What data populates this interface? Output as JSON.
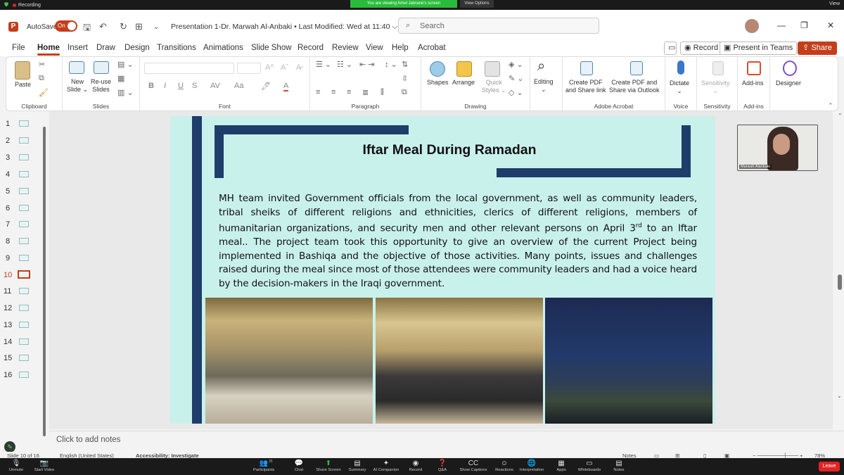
{
  "zoom": {
    "recording_label": "Recording",
    "viewing_banner": "You are viewing Amel Jabrane's screen",
    "view_options": "View Options",
    "view_label": "View",
    "toolbar": [
      {
        "icon": "mic-muted-icon",
        "label": "Unmute"
      },
      {
        "icon": "video-off-icon",
        "label": "Start Video"
      },
      {
        "icon": "participants-icon",
        "label": "Participants",
        "count": "35"
      },
      {
        "icon": "chat-icon",
        "label": "Chat"
      },
      {
        "icon": "share-screen-icon",
        "label": "Share Screen"
      },
      {
        "icon": "summary-icon",
        "label": "Summary"
      },
      {
        "icon": "ai-companion-icon",
        "label": "AI Companion"
      },
      {
        "icon": "record-icon",
        "label": "Record"
      },
      {
        "icon": "qa-icon",
        "label": "Q&A"
      },
      {
        "icon": "captions-icon",
        "label": "Show Captions"
      },
      {
        "icon": "reactions-icon",
        "label": "Reactions"
      },
      {
        "icon": "interpretation-icon",
        "label": "Interpretation"
      },
      {
        "icon": "apps-icon",
        "label": "Apps"
      },
      {
        "icon": "whiteboards-icon",
        "label": "Whiteboards"
      },
      {
        "icon": "notes-icon",
        "label": "Notes"
      }
    ],
    "leave_label": "Leave"
  },
  "titlebar": {
    "autosave_label": "AutoSave",
    "toggle_state": "On",
    "doc_title": "Presentation 1-Dr. Marwah Al-Anbaki • Last Modified: Wed at 11:40 ⌵",
    "search_placeholder": "Search"
  },
  "menu": {
    "tabs": [
      "File",
      "Home",
      "Insert",
      "Draw",
      "Design",
      "Transitions",
      "Animations",
      "Slide Show",
      "Record",
      "Review",
      "View",
      "Help",
      "Acrobat"
    ],
    "active_tab": "Home",
    "record_label": "Record",
    "present_label": "Present in Teams",
    "share_label": "Share"
  },
  "ribbon": {
    "groups": {
      "clipboard": "Clipboard",
      "slides": "Slides",
      "font": "Font",
      "paragraph": "Paragraph",
      "drawing": "Drawing",
      "acrobat": "Adobe Acrobat",
      "voice": "Voice",
      "sensitivity": "Sensitivity",
      "addins": "Add-ins"
    },
    "buttons": {
      "paste": "Paste",
      "new_slide_1": "New",
      "new_slide_2": "Slide ⌄",
      "reuse_1": "Re-use",
      "reuse_2": "Slides",
      "shapes": "Shapes",
      "arrange": "Arrange",
      "quick_1": "Quick",
      "quick_2": "Styles ⌄",
      "editing": "Editing",
      "create_pdf_1": "Create PDF",
      "create_pdf_2": "and Share link",
      "create_pdf_out_1": "Create PDF and",
      "create_pdf_out_2": "Share via Outlook",
      "dictate": "Dictate",
      "sensitivity": "Sensitivity",
      "addins": "Add-ins",
      "designer": "Designer"
    },
    "font_buttons": [
      "B",
      "I",
      "U",
      "S",
      "AV",
      "Aa",
      "A"
    ]
  },
  "thumbnails": {
    "numbers": [
      "1",
      "2",
      "3",
      "4",
      "5",
      "6",
      "7",
      "8",
      "9",
      "10",
      "11",
      "12",
      "13",
      "14",
      "15",
      "16"
    ],
    "selected": "10"
  },
  "slide": {
    "title": "Iftar Meal During Ramadan",
    "body_before_sup": "MH team invited Government officials from the local government, as well as community leaders, tribal sheiks of different religions and ethnicities, clerics of different religions, members of humanitarian organizations, and security men and other relevant persons on April 3",
    "sup": "rd",
    "body_after_sup": " to an Iftar meal.. The project team took this opportunity to give an overview of the current Project being implemented in Bashiqa and the objective of those activities. Many points, issues and challenges raised during the meal since most of those attendees were community leaders and had a voice heard by the decision-makers in the Iraqi government."
  },
  "camera": {
    "name": "Marwah Alanbaki"
  },
  "notes": {
    "placeholder": "Click to add notes"
  },
  "status": {
    "slide_of": "Slide 10 of 16",
    "language": "English (United States)",
    "accessibility": "Accessibility: Investigate",
    "notes": "Notes",
    "zoom": "78%"
  },
  "colors": {
    "accent": "#c43e1c",
    "slide_bg": "#c9f1ec",
    "navy": "#1f3d6b",
    "zoom_green": "#2bbb3c"
  }
}
